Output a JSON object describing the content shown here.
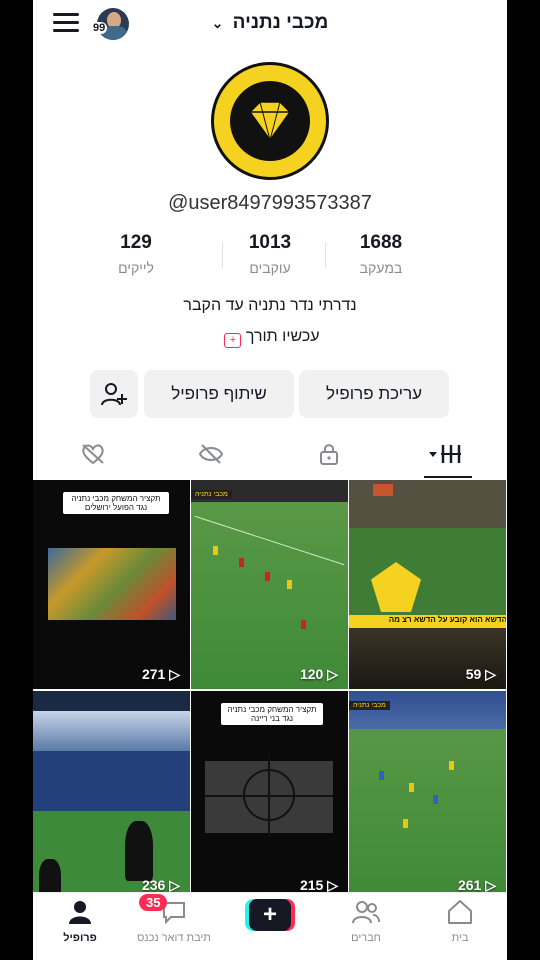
{
  "header": {
    "title": "מכבי נתניה",
    "avatar_badge": "99"
  },
  "profile": {
    "username": "@user8497993573387",
    "bio": "נדרתי נדר נתניה עד הקבר",
    "live_text": "עכשיו תורך",
    "stats": [
      {
        "label": "במעקב",
        "value": "1688"
      },
      {
        "label": "עוקבים",
        "value": "1013"
      },
      {
        "label": "לייקים",
        "value": "129"
      }
    ]
  },
  "actions": {
    "edit_label": "עריכת פרופיל",
    "share_label": "שיתוף פרופיל"
  },
  "videos": [
    {
      "views": "271",
      "caption_top": "תקציר המשחק מכבי נתניה",
      "caption_bottom": "נגד הפועל ירושלים"
    },
    {
      "views": "120",
      "tag": "מכבי נתניה"
    },
    {
      "views": "59",
      "banner": "הדשא הוא קובע על הדשא רצ מה"
    },
    {
      "views": "236"
    },
    {
      "views": "215",
      "caption_top": "תקציר המשחק מכבי נתניה",
      "caption_bottom": "נגד בני ריינה"
    },
    {
      "views": "261",
      "tag": "מכבי נתניה"
    }
  ],
  "nav": {
    "home": "בית",
    "friends": "חברים",
    "inbox": "תיבת דואר נכנס",
    "inbox_badge": "35",
    "profile": "פרופיל"
  },
  "colors": {
    "accent": "#fe2c55",
    "cyan": "#25f4ee",
    "club_yellow": "#f5d21f"
  }
}
